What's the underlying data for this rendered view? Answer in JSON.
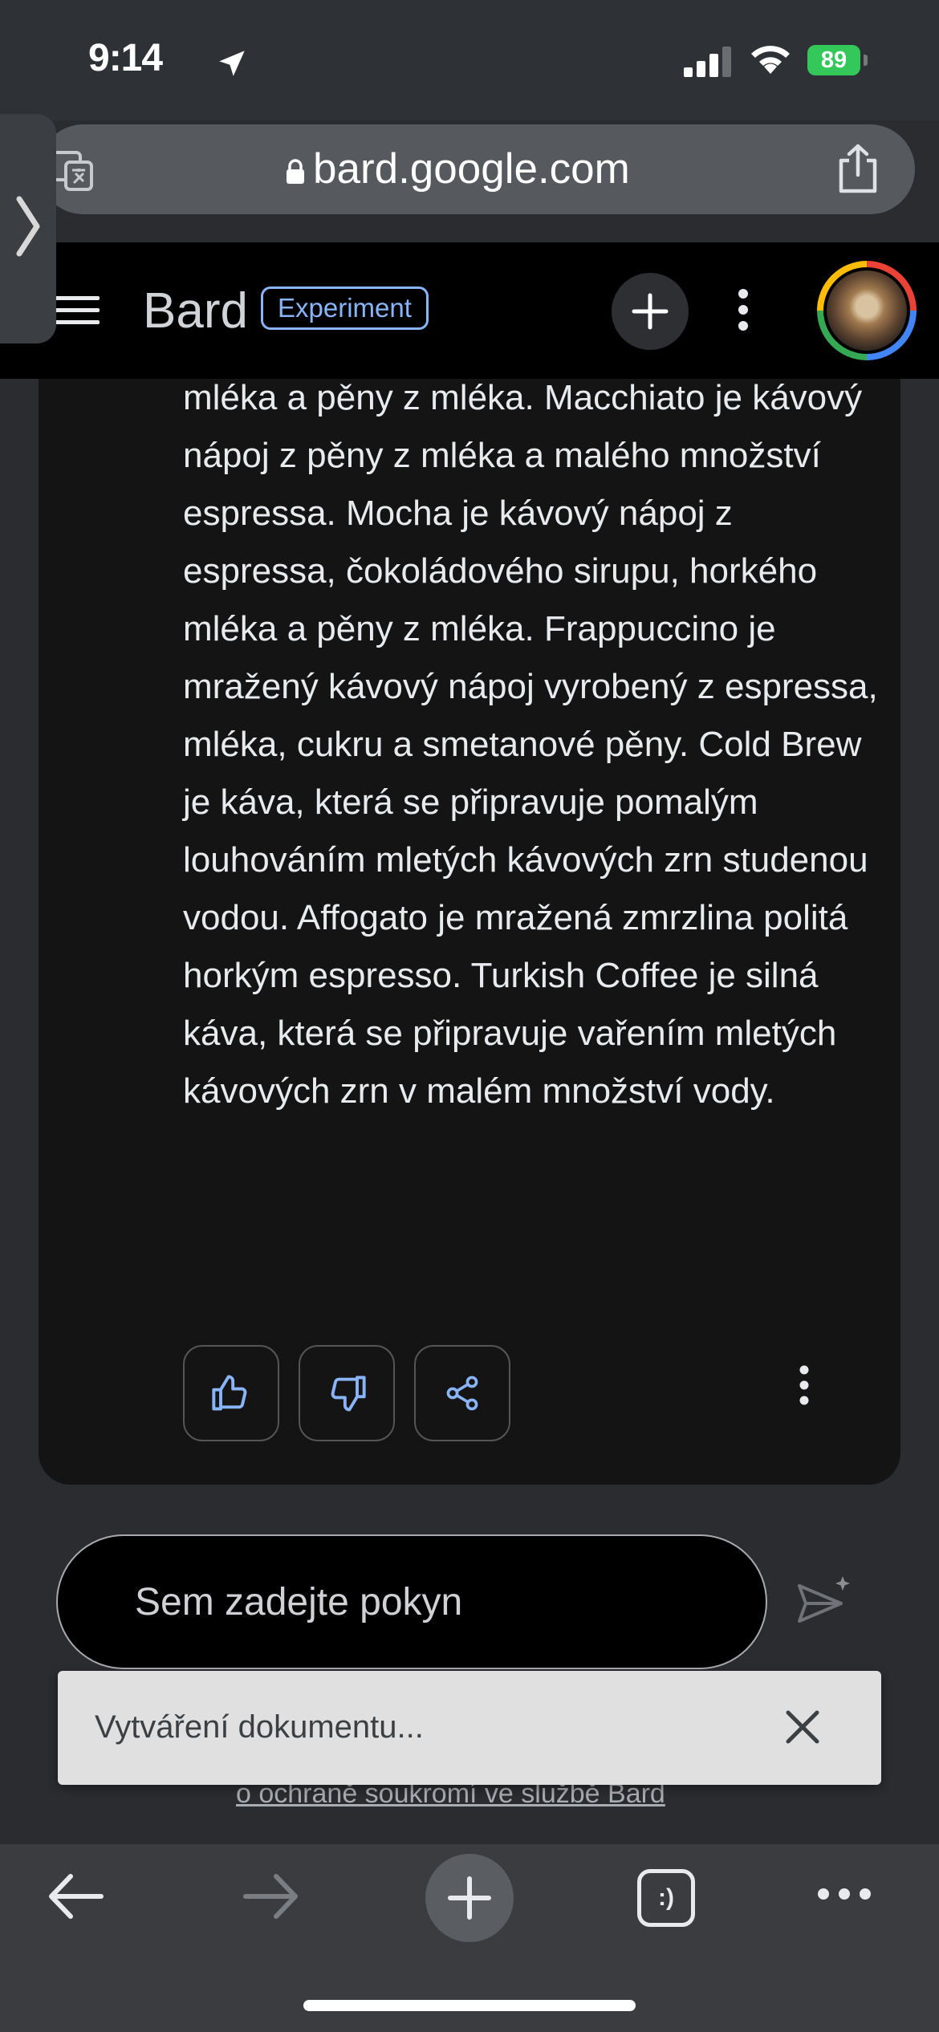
{
  "status_bar": {
    "time": "9:14",
    "battery": "89"
  },
  "browser": {
    "url": "bard.google.com"
  },
  "header": {
    "logo": "Bard",
    "badge": "Experiment"
  },
  "response": {
    "text": "mléka a pěny z mléka. Macchiato je kávový nápoj z pěny z mléka a malého množství espressa. Mocha je kávový nápoj z espressa, čokoládového sirupu, horkého mléka a pěny z mléka. Frappuccino je mražený kávový nápoj vyrobený z espressa, mléka, cukru a smetanové pěny. Cold Brew je káva, která se připravuje pomalým louhováním mletých kávových zrn studenou vodou. Affogato je mražená zmrzlina politá horkým espresso. Turkish Coffee je silná káva, která se připravuje vařením mletých kávových zrn v malém množství vody."
  },
  "prompt": {
    "placeholder": "Sem zadejte pokyn"
  },
  "toast": {
    "text": "Vytváření dokumentu..."
  },
  "footer": {
    "privacy_link": "o ochraně soukromí ve službě Bard"
  },
  "toolbar": {
    "tabs_label": ":)"
  },
  "colors": {
    "accent": "#8ab4f8",
    "battery": "#34c759",
    "card": "#141414",
    "header": "#000000"
  },
  "icons": [
    "location-icon",
    "signal-icon",
    "wifi-icon",
    "translate-icon",
    "lock-icon",
    "share-icon",
    "chevron-right-icon",
    "menu-icon",
    "plus-icon",
    "more-vert-icon",
    "thumbs-up-icon",
    "thumbs-down-icon",
    "share-nodes-icon",
    "send-icon",
    "close-icon",
    "back-arrow-icon",
    "forward-arrow-icon",
    "more-horiz-icon"
  ]
}
